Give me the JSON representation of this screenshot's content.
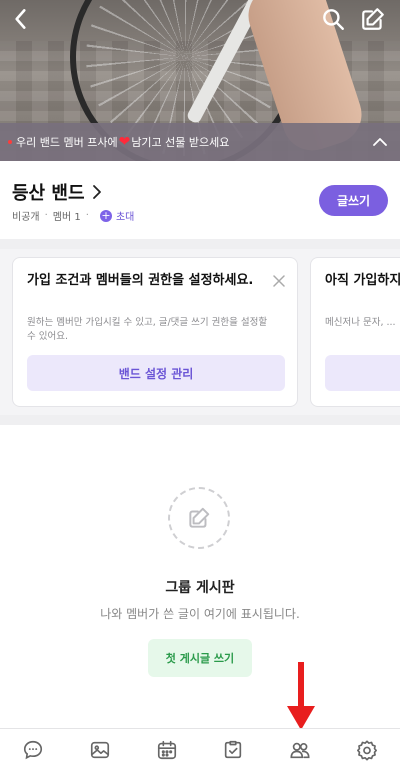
{
  "cover": {
    "notice_part1": "우리 밴드 멤버 프사에",
    "notice_heart": "❤",
    "notice_part2": "남기고 선물 받으세요",
    "icons": [
      "back-arrow-icon",
      "search-icon",
      "edit-icon",
      "chevron-up-icon"
    ]
  },
  "band": {
    "title": "등산 밴드",
    "privacy": "비공개",
    "members": "멤버 1",
    "invite_plus": "+",
    "invite": "초대",
    "write_button": "글쓰기"
  },
  "cards": [
    {
      "title": "가입 조건과 멤버들의 권한을 설정하세요.",
      "desc": "원하는 멤버만 가입시킬 수 있고, 글/댓글 쓰기 권한을 설정할 수 있어요.",
      "button": "밴드 설정 관리"
    },
    {
      "title": "아직 가입하지 않은 멤버를 초대해 보세요.",
      "desc": "메신저나 문자, ..."
    }
  ],
  "empty": {
    "title": "그룹 게시판",
    "desc": "나와 멤버가 쓴 글이 여기에 표시됩니다.",
    "button": "첫 게시글 쓰기"
  },
  "bottom_nav": [
    "chat-icon",
    "photo-icon",
    "calendar-icon",
    "check-icon",
    "members-icon",
    "settings-icon"
  ],
  "colors": {
    "accent": "#7b5fe0",
    "green_text": "#2a9a4a",
    "annotation_arrow": "#e81e1e"
  }
}
